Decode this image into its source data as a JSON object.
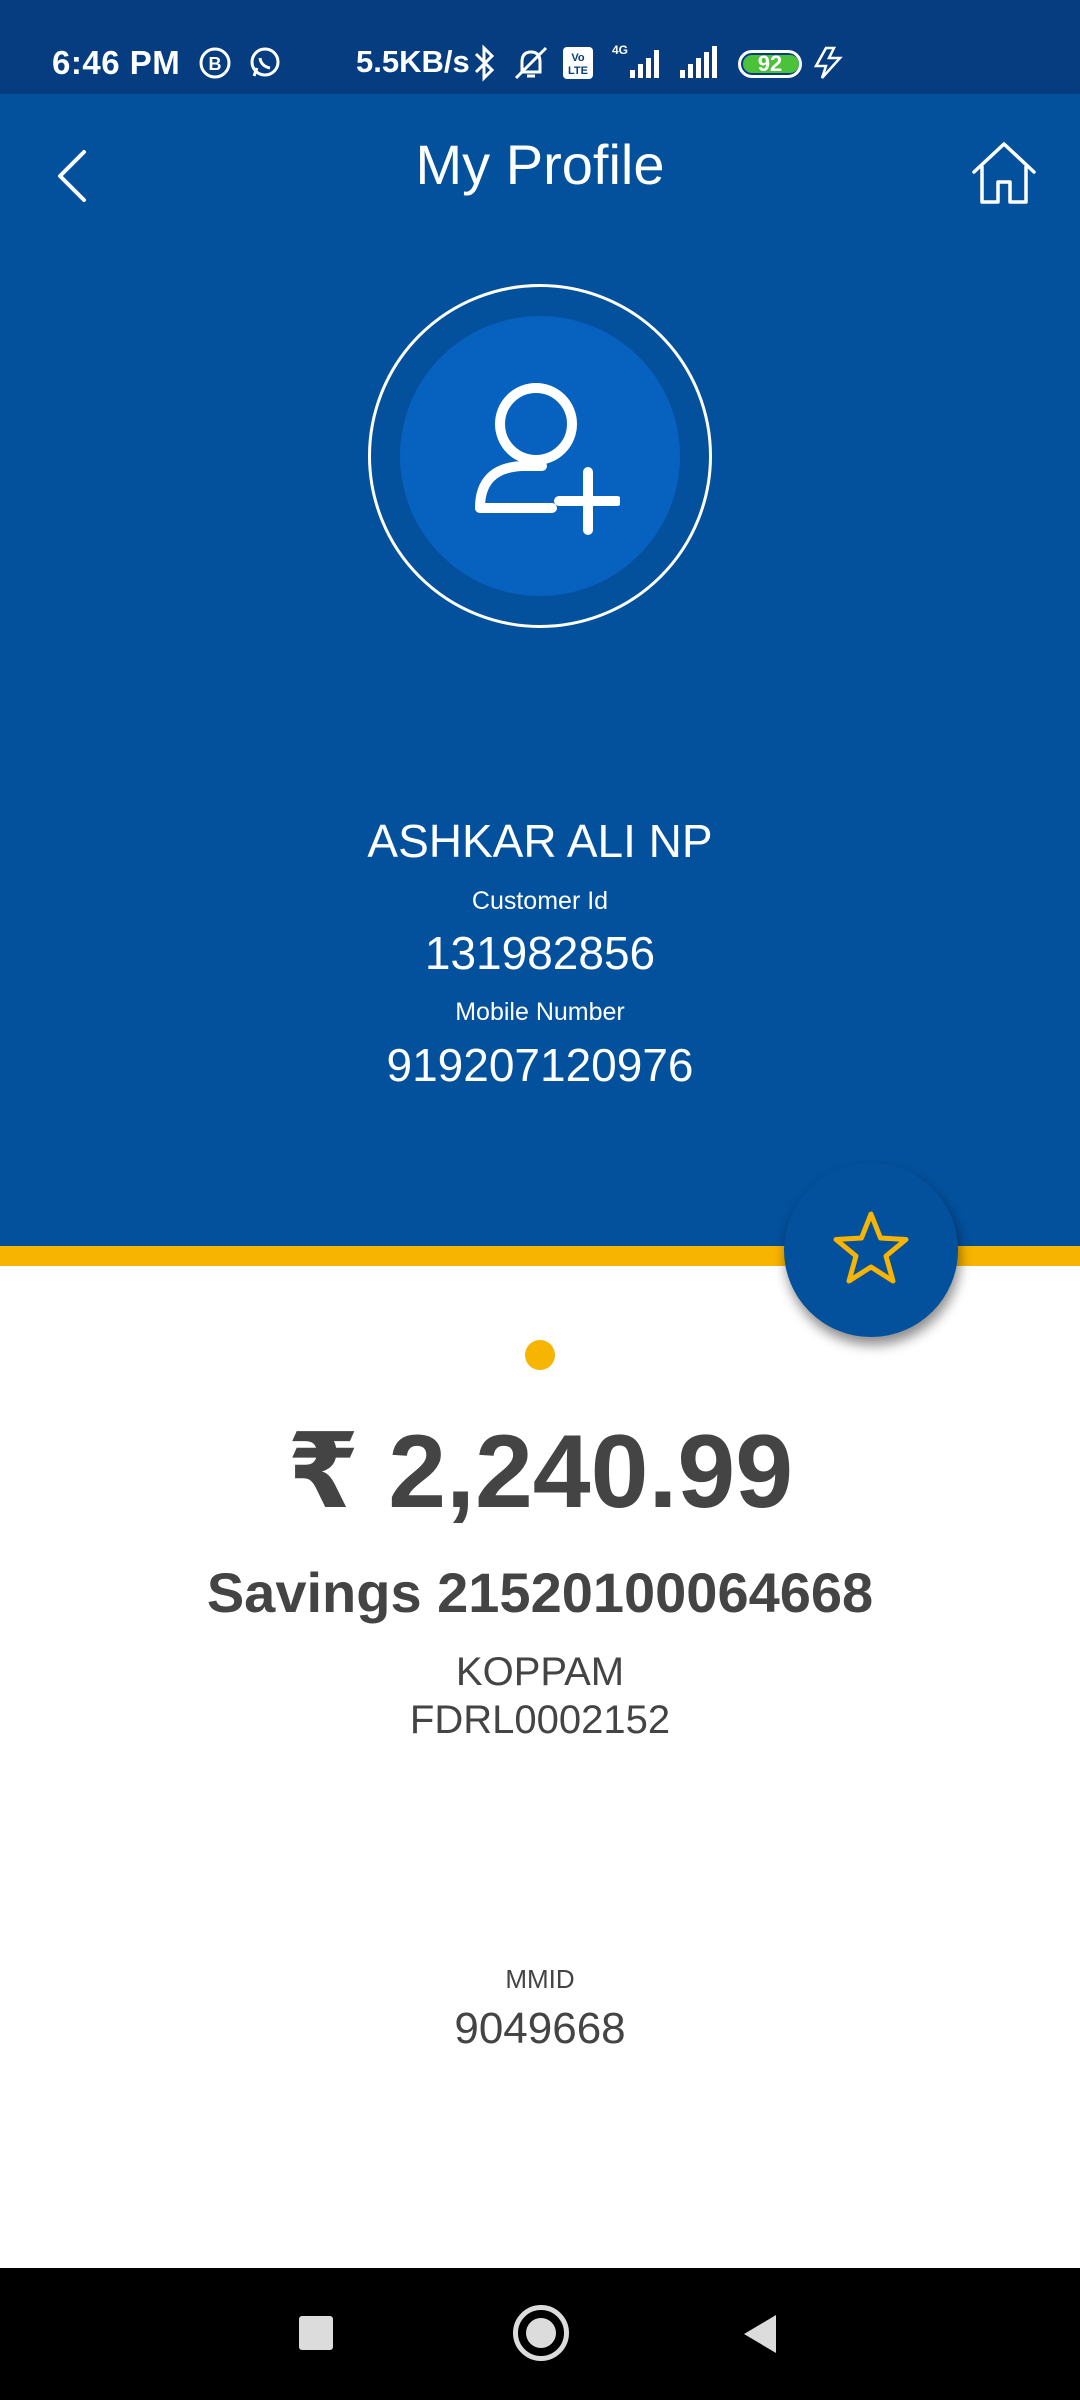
{
  "status_bar": {
    "time": "6:46 PM",
    "network_speed": "5.5KB/s",
    "battery_level": "92",
    "icons": [
      "b-icon",
      "whatsapp-icon",
      "bluetooth-icon",
      "alarm-off-icon",
      "volte-icon",
      "signal-4g-icon",
      "signal-icon",
      "battery-icon",
      "charging-icon"
    ]
  },
  "header": {
    "title": "My Profile",
    "back_icon": "chevron-left-icon",
    "home_icon": "home-icon"
  },
  "profile": {
    "avatar_icon": "add-user-icon",
    "name": "ASHKAR ALI NP",
    "customer_id_label": "Customer Id",
    "customer_id": "131982856",
    "mobile_label": "Mobile Number",
    "mobile_number": "919207120976"
  },
  "favorite_icon": "star-icon",
  "account": {
    "balance": "₹ 2,240.99",
    "account_name": "Savings 21520100064668",
    "branch": "KOPPAM",
    "ifsc": "FDRL0002152",
    "mmid_label": "MMID",
    "mmid": "9049668"
  },
  "colors": {
    "primary": "#03509c",
    "status_bar": "#053d80",
    "accent": "#f7b400",
    "text_dark": "#444444"
  }
}
